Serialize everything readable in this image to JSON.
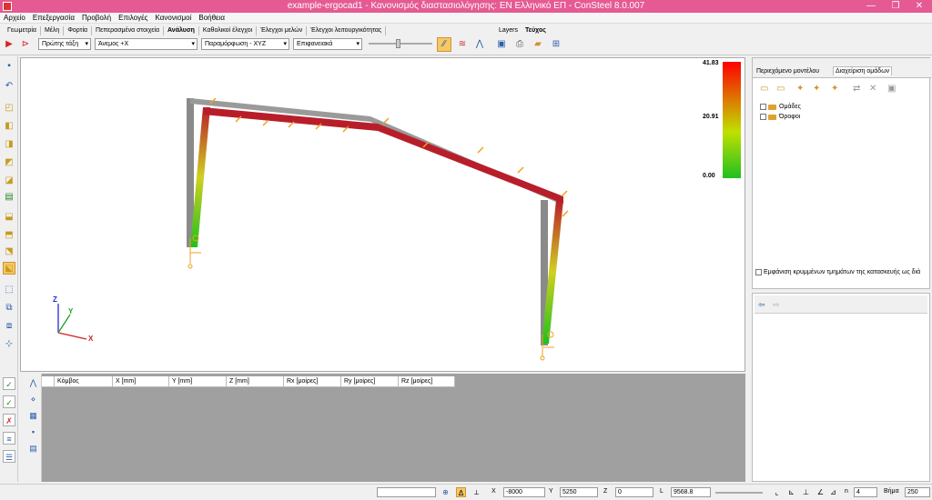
{
  "window": {
    "title": "example-ergocad1 - Κανονισμός διαστασιολόγησης: EN Ελληνικό ΕΠ - ConSteel 8.0.007",
    "minimize": "—",
    "maximize": "❐",
    "close": "✕"
  },
  "menu": [
    "Αρχείο",
    "Επεξεργασία",
    "Προβολή",
    "Επιλογές",
    "Κανονισμοί",
    "Βοήθεια"
  ],
  "ribbon_tabs": [
    "Γεωμετρία",
    "Μέλη",
    "Φορτία",
    "Πεπερασμένα στοιχεία",
    "Ανάλυση",
    "Καθολικοί έλεγχοι",
    "Έλεγχοι μελών",
    "Έλεγχοι λειτουργικότητας"
  ],
  "ribbon_active": "Ανάλυση",
  "layers_tabs": [
    "Layers",
    "Τεύχος"
  ],
  "selects": {
    "analysis": "Πρώτης τάξη",
    "loadcase": "Άνεμος +X",
    "result": "Παραμόρφωση - XYZ",
    "display": "Επιφανειακά"
  },
  "legend": {
    "max": "41.83",
    "mid": "20.91",
    "min": "0.00"
  },
  "axes": {
    "x": "X",
    "y": "Y",
    "z": "Z"
  },
  "table_headers": [
    "Κόμβος",
    "X [mm]",
    "Y [mm]",
    "Z [mm]",
    "Rx [μοίρες]",
    "Ry [μοίρες]",
    "Rz [μοίρες]"
  ],
  "right_panel": {
    "tab1": "Περιεχόμενο μοντέλου",
    "tab2": "Διαχείριση ομάδων",
    "tree": [
      "Ομάδες",
      "Όροφοι"
    ],
    "footer": "Εμφάνιση κρυμμένων τμημάτων της κατασκευής ως διά"
  },
  "status": {
    "x_label": "X",
    "x_val": "-8000",
    "y_label": "Y",
    "y_val": "5250",
    "z_label": "Z",
    "z_val": "0",
    "l_label": "L",
    "l_val": "9568.8",
    "n_label": "n",
    "n_val": "4",
    "step_label": "Βήμα",
    "step_val": "250"
  },
  "colors": {
    "title_bar": "#e55a93",
    "frame_red": "#b81e2a",
    "frame_gray": "#8a8a8a",
    "load_arrow": "#f0a020"
  }
}
